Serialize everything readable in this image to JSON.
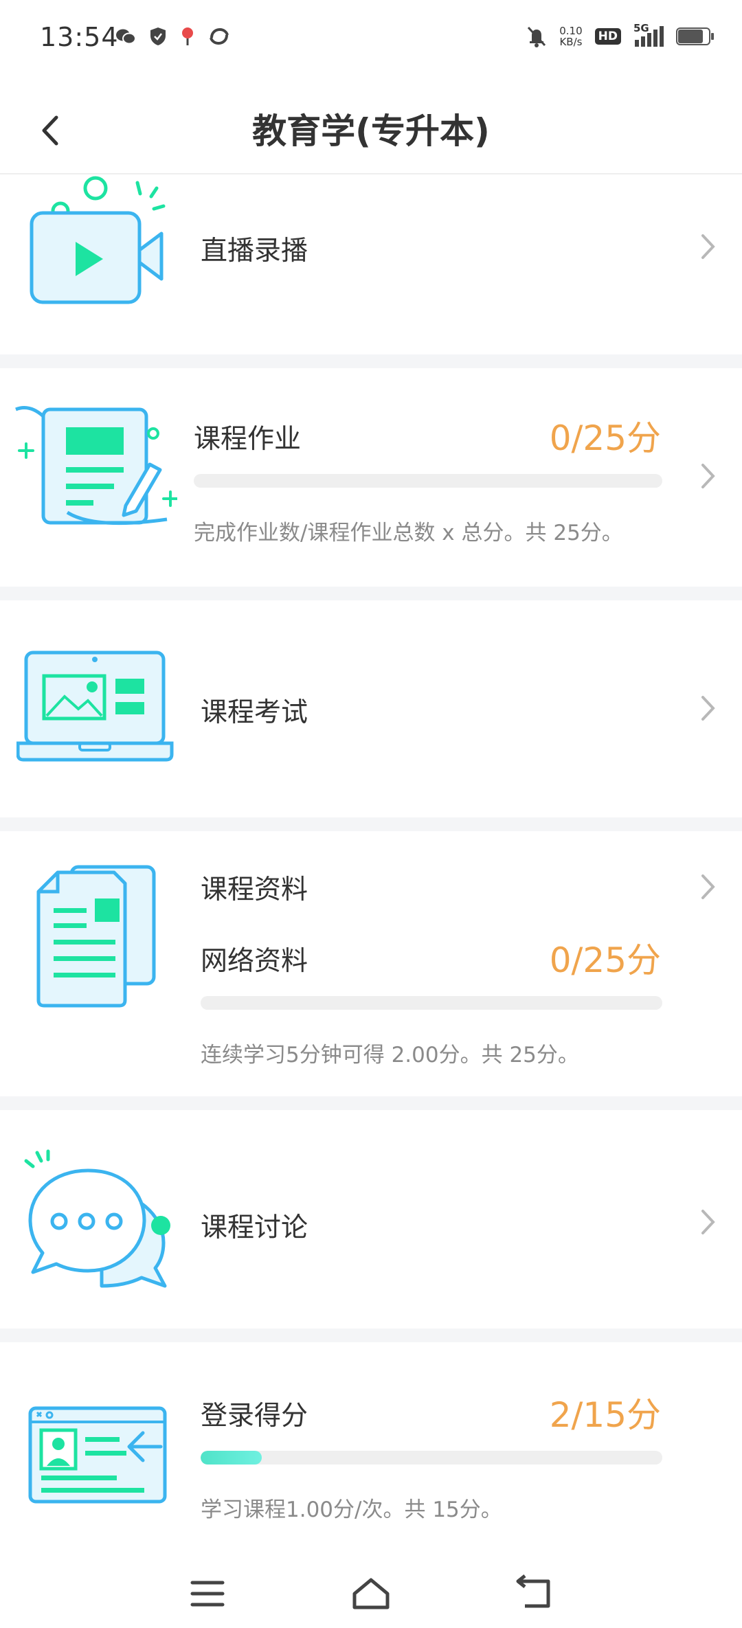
{
  "status_bar": {
    "time": "13:54",
    "net_speed_value": "0.10",
    "net_speed_unit": "KB/s",
    "hd": "HD",
    "network": "5G"
  },
  "header": {
    "title": "教育学(专升本)"
  },
  "colors": {
    "accent": "#f0a44c",
    "icon_blue": "#3bb4ef",
    "icon_green": "#1de3a1"
  },
  "sections": {
    "live": {
      "label": "直播录播",
      "icon": "video-camera-icon"
    },
    "homework": {
      "label": "课程作业",
      "score": "0/25分",
      "progress": 0,
      "desc": "完成作业数/课程作业总数 x 总分。共 25分。",
      "icon": "homework-scroll-icon"
    },
    "exam": {
      "label": "课程考试",
      "icon": "laptop-icon"
    },
    "materials": {
      "label": "课程资料",
      "sub_label": "网络资料",
      "score": "0/25分",
      "progress": 0,
      "desc": "连续学习5分钟可得 2.00分。共 25分。",
      "icon": "documents-icon"
    },
    "discussion": {
      "label": "课程讨论",
      "icon": "chat-bubble-icon"
    },
    "login": {
      "label": "登录得分",
      "score": "2/15分",
      "progress": 0.133,
      "desc": "学习课程1.00分/次。共  15分。",
      "icon": "login-card-icon"
    }
  }
}
